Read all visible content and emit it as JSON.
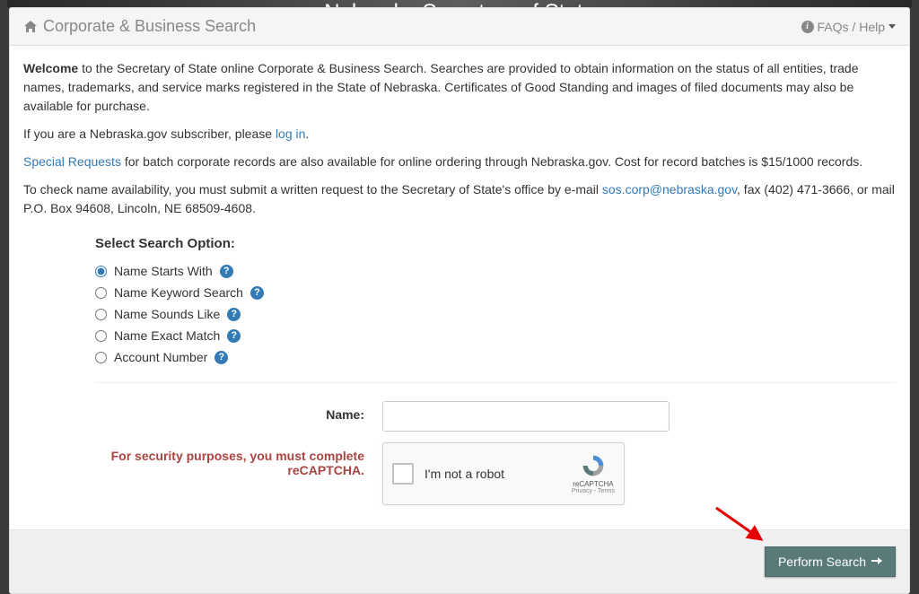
{
  "banner": {
    "org_name": "Nebraska Secretary of State"
  },
  "header": {
    "title": "Corporate & Business Search",
    "help_label": "FAQs / Help"
  },
  "intro": {
    "welcome_bold": "Welcome",
    "welcome_rest": " to the Secretary of State online Corporate & Business Search. Searches are provided to obtain information on the status of all entities, trade names, trademarks, and service marks registered in the State of Nebraska. Certificates of Good Standing and images of filed documents may also be available for purchase.",
    "subscriber_pre": "If you are a Nebraska.gov subscriber, please ",
    "login_link": "log in",
    "subscriber_post": ".",
    "special_link": "Special Requests",
    "special_rest": " for batch corporate records are also available for online ordering through Nebraska.gov. Cost for record batches is $15/1000 records.",
    "avail_pre": "To check name availability, you must submit a written request to the Secretary of State's office by e-mail ",
    "avail_email": "sos.corp@nebraska.gov",
    "avail_post": ", fax (402) 471-3666, or mail P.O. Box 94608, Lincoln, NE 68509-4608."
  },
  "search": {
    "heading": "Select Search Option:",
    "options": [
      {
        "label": "Name Starts With",
        "checked": true
      },
      {
        "label": "Name Keyword Search",
        "checked": false
      },
      {
        "label": "Name Sounds Like",
        "checked": false
      },
      {
        "label": "Name Exact Match",
        "checked": false
      },
      {
        "label": "Account Number",
        "checked": false
      }
    ],
    "name_label": "Name:",
    "name_value": "",
    "captcha_warning": "For security purposes, you must complete reCAPTCHA.",
    "captcha_text": "I'm not a robot",
    "captcha_brand": "reCAPTCHA",
    "captcha_terms": "Privacy - Terms"
  },
  "footer": {
    "button_label": "Perform Search"
  }
}
